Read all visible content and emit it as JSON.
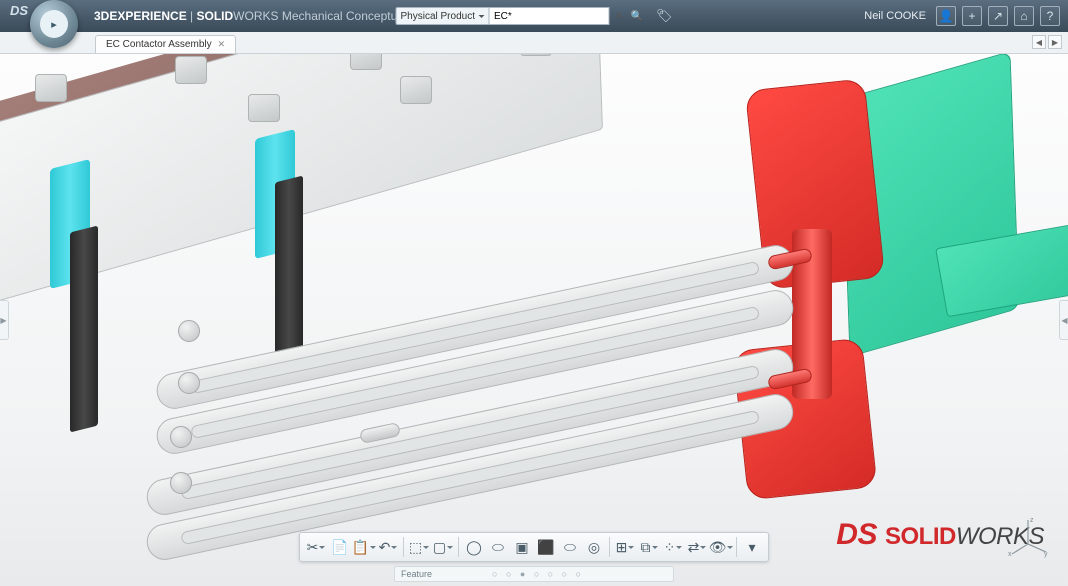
{
  "header": {
    "ds_glyph": "DS",
    "title_bold_prefix": "3D",
    "title_bold": "EXPERIENCE",
    "title_sep": " | ",
    "title_app_bold": "SOLID",
    "title_app_rest": "WORKS",
    "title_suffix": " Mechanical Conceptual",
    "search_type": "Physical Product",
    "search_value": "EC*",
    "search_clear": "✕",
    "search_go": "🔍",
    "tag_glyph": "🏷",
    "user": "Neil COOKE",
    "btn_user": "👤",
    "btn_plus": "+",
    "btn_share": "↗",
    "btn_home": "⌂",
    "btn_help": "?"
  },
  "tabs": {
    "active": "EC Contactor Assembly",
    "close": "✕",
    "nav_prev": "◀",
    "nav_next": "▶"
  },
  "toolbar": {
    "items": [
      {
        "name": "cut-icon",
        "glyph": "✂",
        "dd": true
      },
      {
        "name": "copy-icon",
        "glyph": "📄"
      },
      {
        "name": "paste-icon",
        "glyph": "📋",
        "dd": true
      },
      {
        "name": "undo-icon",
        "glyph": "↶",
        "dd": true
      },
      {
        "sep": true
      },
      {
        "name": "new-part-icon",
        "glyph": "⬚",
        "dd": true
      },
      {
        "name": "primitive-icon",
        "glyph": "▢",
        "dd": true
      },
      {
        "sep": true
      },
      {
        "name": "circle-icon",
        "glyph": "◯"
      },
      {
        "name": "ellipse-icon",
        "glyph": "⬭"
      },
      {
        "name": "cube-icon",
        "glyph": "▣"
      },
      {
        "name": "box-icon",
        "glyph": "⬛"
      },
      {
        "name": "capsule-icon",
        "glyph": "⬭"
      },
      {
        "name": "cylinder-icon",
        "glyph": "◎"
      },
      {
        "sep": true
      },
      {
        "name": "assembly-icon",
        "glyph": "⊞",
        "dd": true
      },
      {
        "name": "mate-icon",
        "glyph": "⧉",
        "dd": true
      },
      {
        "name": "pattern-icon",
        "glyph": "⁘",
        "dd": true
      },
      {
        "name": "move-icon",
        "glyph": "⇄",
        "dd": true
      },
      {
        "name": "view-icon",
        "glyph": "👁",
        "dd": true
      },
      {
        "sep": true
      },
      {
        "name": "expand-icon",
        "glyph": "▾"
      }
    ]
  },
  "feature_bar": {
    "label": "Feature",
    "dots": "○ ○ ● ○ ○ ○ ○"
  },
  "watermark": {
    "ds": "DS",
    "solid": "SOLID",
    "works": "WORKS"
  },
  "canvas": {
    "left_handle": "▶",
    "right_handle": "◀",
    "triad": {
      "x": "x",
      "y": "y",
      "z": "z"
    }
  }
}
